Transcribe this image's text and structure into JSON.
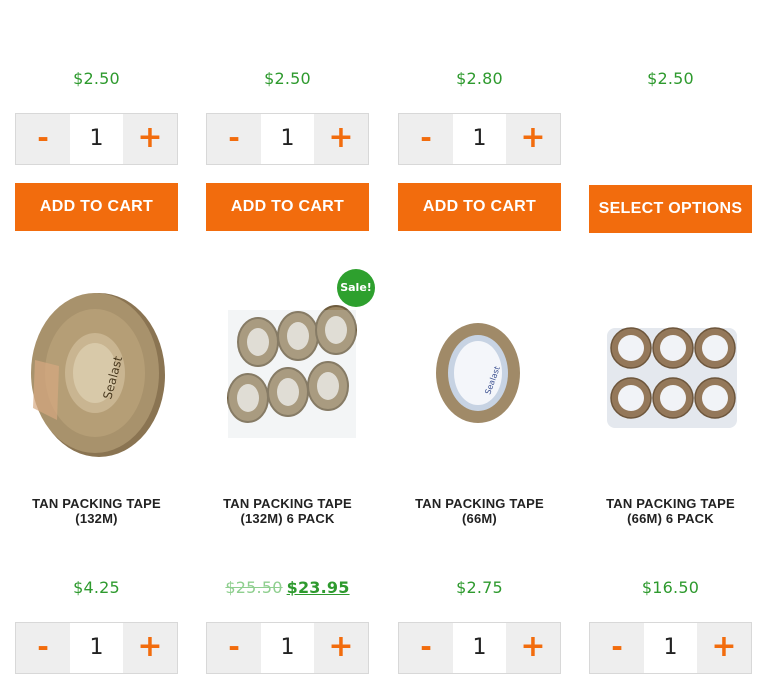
{
  "top_row": [
    {
      "price": "$2.50",
      "qty": "1",
      "button": "ADD TO CART"
    },
    {
      "price": "$2.50",
      "qty": "1",
      "button": "ADD TO CART"
    },
    {
      "price": "$2.80",
      "qty": "1",
      "button": "ADD TO CART"
    },
    {
      "price": "$2.50",
      "button": "SELECT OPTIONS"
    }
  ],
  "qty_controls": {
    "minus": "-",
    "plus": "+"
  },
  "products": [
    {
      "title": "TAN PACKING TAPE (132M)",
      "price": "$4.25",
      "qty": "1"
    },
    {
      "title": "TAN PACKING TAPE (132M) 6 PACK",
      "sale_badge": "Sale!",
      "old_price": "$25.50",
      "new_price": "$23.95",
      "qty": "1"
    },
    {
      "title": "TAN PACKING TAPE (66M)",
      "price": "$2.75",
      "qty": "1"
    },
    {
      "title": "TAN PACKING TAPE (66M) 6 PACK",
      "price": "$16.50",
      "qty": "1"
    }
  ],
  "colors": {
    "accent": "#f26c0d",
    "price": "#2e9a2e",
    "sale_badge": "#2ea02e",
    "tape": "#a08a68"
  }
}
